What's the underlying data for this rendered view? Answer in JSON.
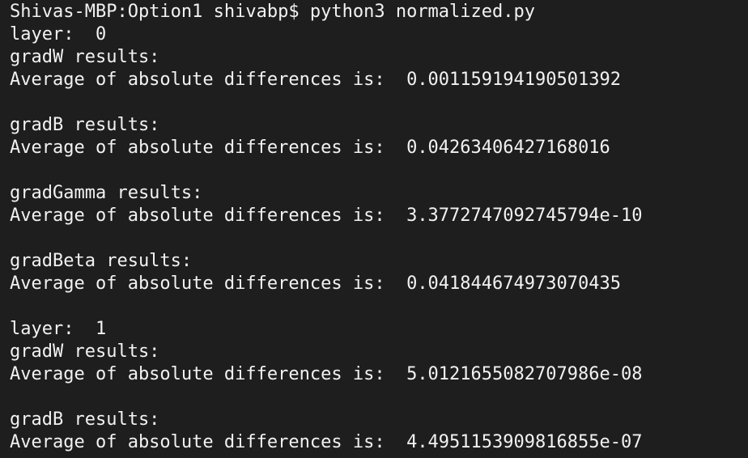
{
  "terminal": {
    "lines": [
      "Shivas-MBP:Option1 shivabp$ python3 normalized.py",
      "layer:  0",
      "gradW results:",
      "Average of absolute differences is:  0.001159194190501392",
      "",
      "gradB results:",
      "Average of absolute differences is:  0.04263406427168016",
      "",
      "gradGamma results:",
      "Average of absolute differences is:  3.3772747092745794e-10",
      "",
      "gradBeta results:",
      "Average of absolute differences is:  0.041844674973070435",
      "",
      "layer:  1",
      "gradW results:",
      "Average of absolute differences is:  5.0121655082707986e-08",
      "",
      "gradB results:",
      "Average of absolute differences is:  4.4951153909816855e-07"
    ]
  },
  "colors": {
    "background": "#1e1e1e",
    "foreground": "#f2f2f2"
  }
}
